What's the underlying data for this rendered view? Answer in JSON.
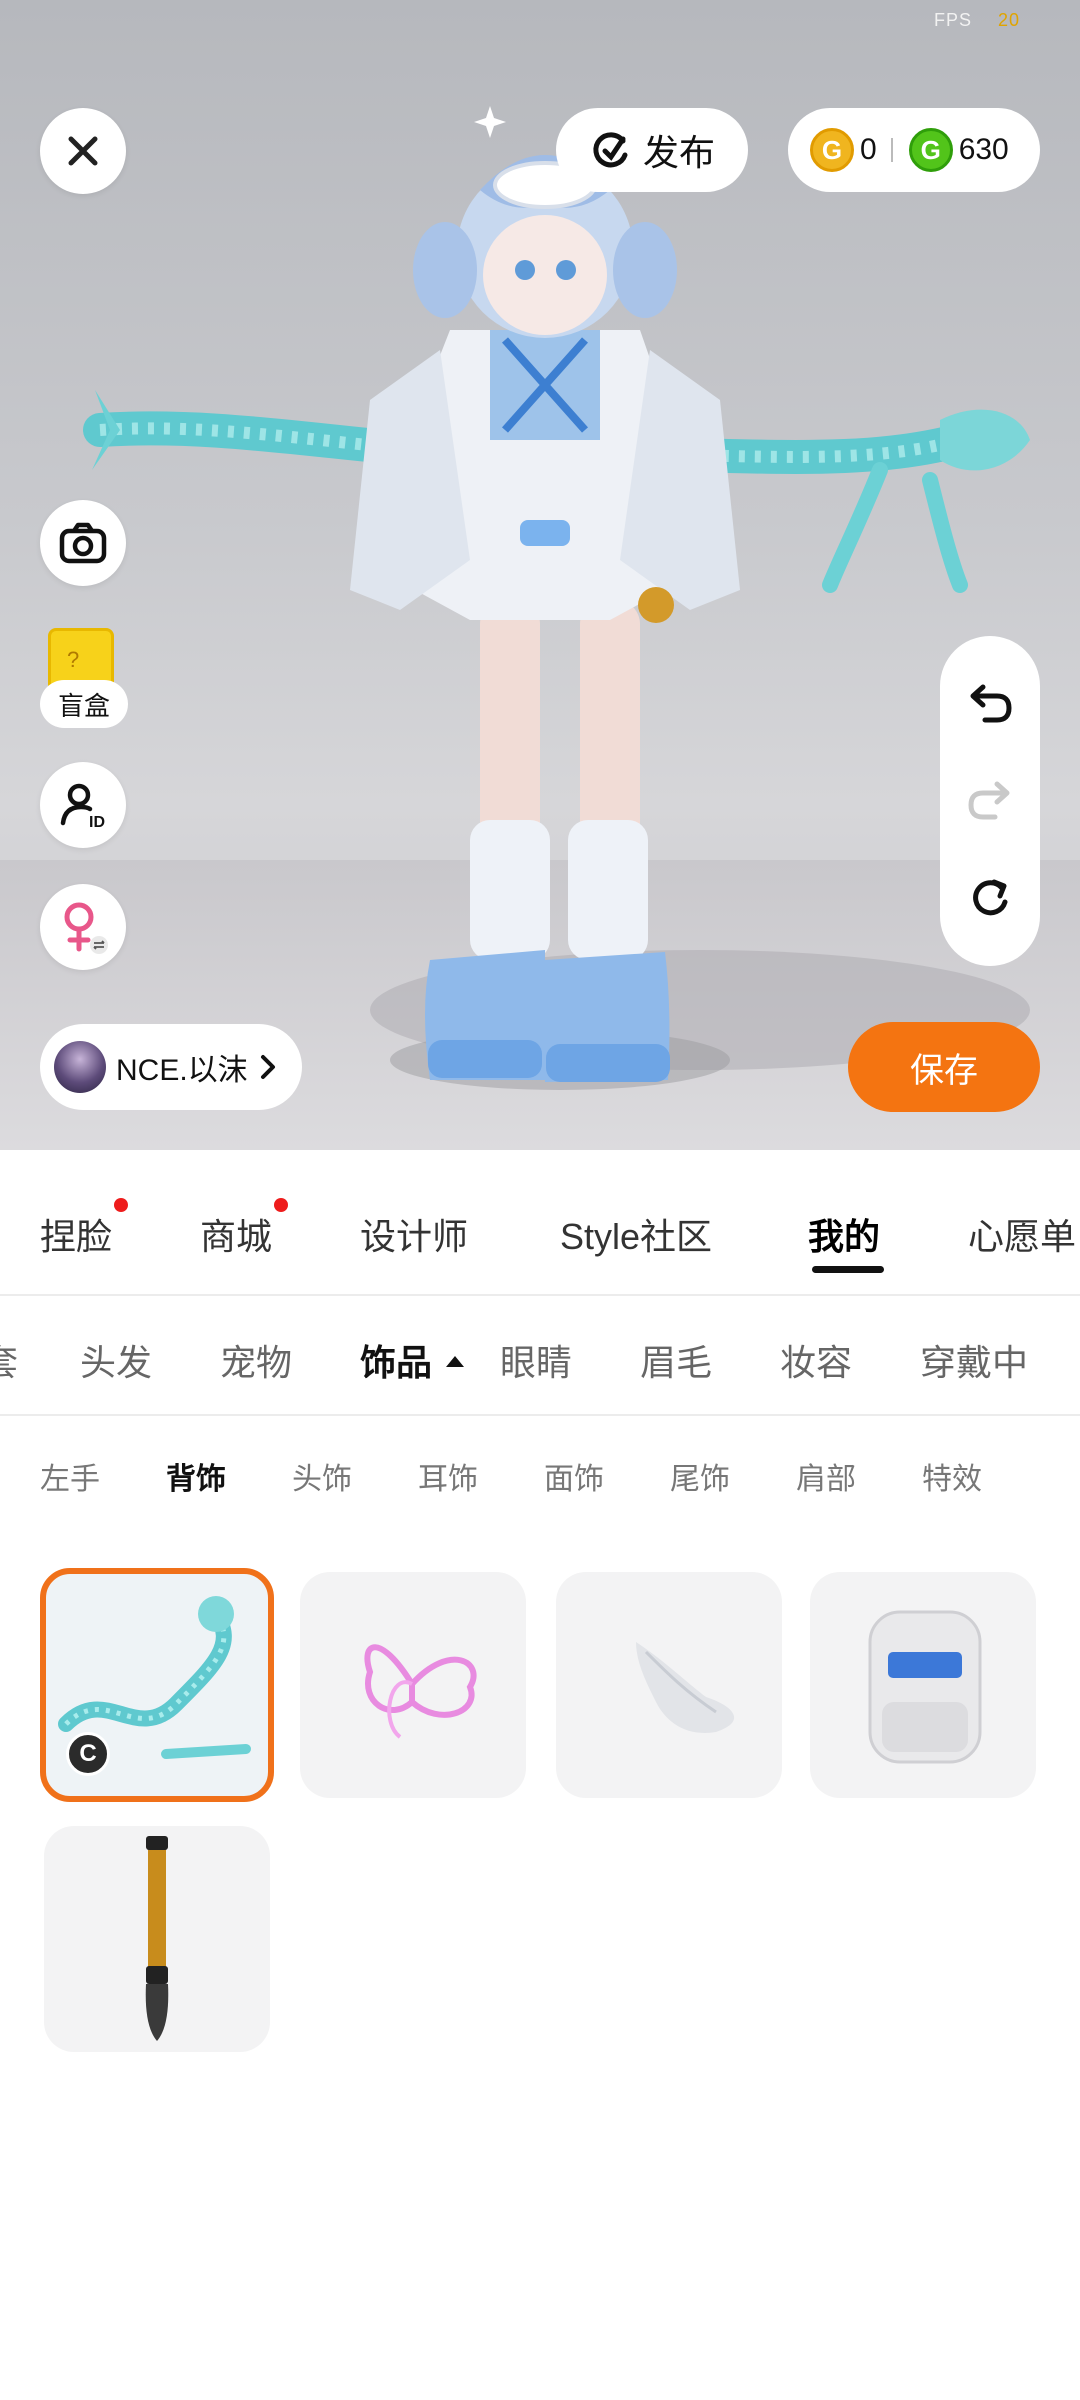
{
  "fps": {
    "label": "FPS",
    "value": "20"
  },
  "publish": {
    "label": "发布"
  },
  "currency": {
    "gold": "0",
    "green": "630",
    "gold_symbol": "G",
    "green_symbol": "G"
  },
  "side": {
    "blind_box_label": "盲盒",
    "blind_box_mark": "?"
  },
  "user": {
    "name": "NCE.以沫"
  },
  "save": {
    "label": "保存"
  },
  "main_tabs": [
    {
      "label": "捏脸",
      "dot": true
    },
    {
      "label": "商城",
      "dot": true
    },
    {
      "label": "设计师",
      "dot": false
    },
    {
      "label": "Style社区",
      "dot": false
    },
    {
      "label": "我的",
      "dot": false,
      "active": true
    },
    {
      "label": "心愿单",
      "dot": false
    }
  ],
  "sub_tabs": [
    "套",
    "头发",
    "宠物",
    "饰品",
    "眼睛",
    "眉毛",
    "妆容",
    "穿戴中"
  ],
  "sub_tabs_active": "饰品",
  "category_tabs": [
    "左手",
    "背饰",
    "头饰",
    "耳饰",
    "面饰",
    "尾饰",
    "肩部",
    "特效"
  ],
  "category_active": "背饰",
  "items": [
    {
      "name": "ice-dragon",
      "selected": true,
      "badge": "C"
    },
    {
      "name": "pink-butterfly-wings",
      "selected": false
    },
    {
      "name": "white-angel-wings",
      "selected": false
    },
    {
      "name": "white-backpack",
      "selected": false
    },
    {
      "name": "calligraphy-brush",
      "selected": false
    }
  ],
  "colors": {
    "accent": "#f47411",
    "selected_border": "#f0711a",
    "notification": "#ee1c1c",
    "gold_coin": "#f0b51f",
    "green_coin": "#52c41a",
    "female_icon": "#e8578a"
  }
}
